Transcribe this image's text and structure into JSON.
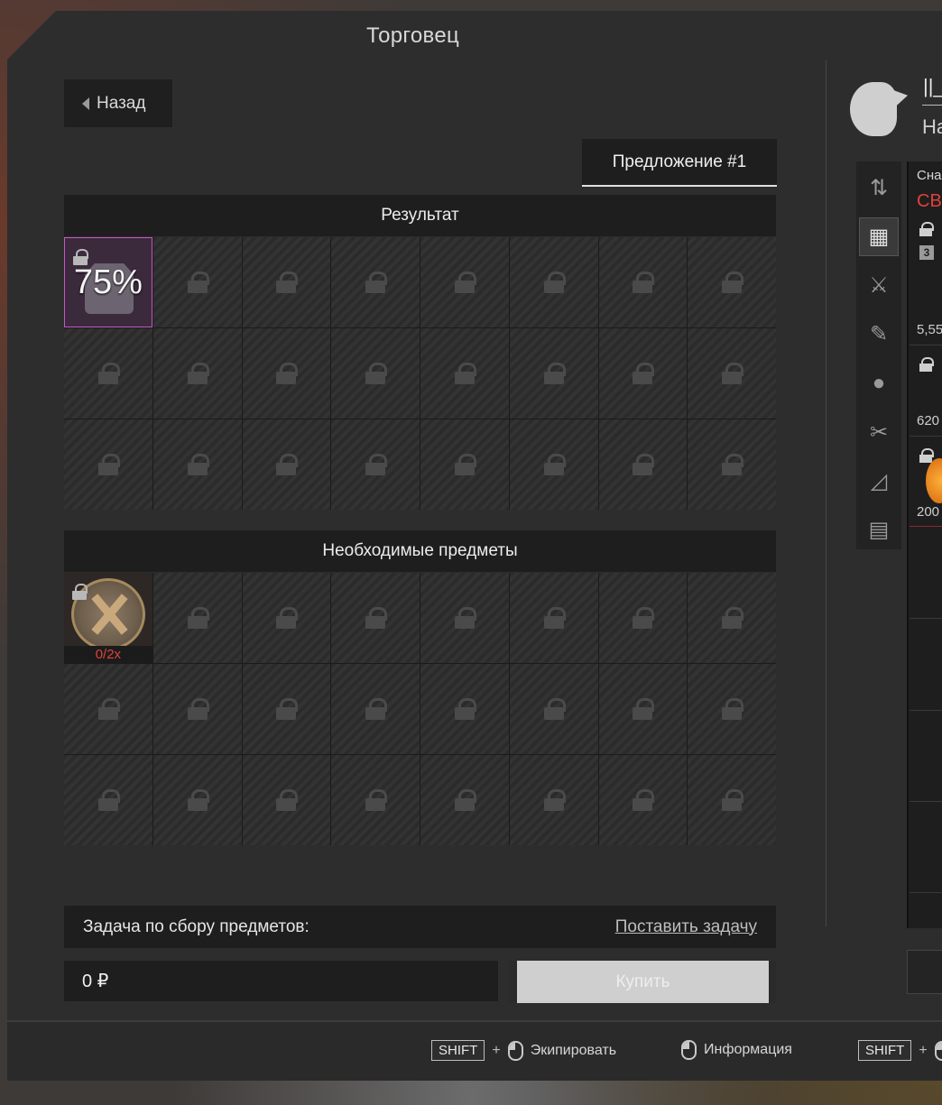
{
  "window": {
    "title": "Торговец"
  },
  "nav": {
    "back_label": "Назад"
  },
  "offer_tab": {
    "label": "Предложение #1"
  },
  "result": {
    "title": "Результат",
    "item": {
      "percent": "75%"
    }
  },
  "required": {
    "title": "Необходимые предметы",
    "item": {
      "count": "0/2x"
    }
  },
  "task": {
    "label": "Задача по сбору предметов:",
    "link": "Поставить задачу"
  },
  "price": {
    "value": "0 ₽"
  },
  "buy": {
    "label": "Купить"
  },
  "player": {
    "name": "||_",
    "sub": "На"
  },
  "categories": [
    {
      "icon": "sort-icon",
      "glyph": "⇅"
    },
    {
      "icon": "grid-icon",
      "glyph": "▦"
    },
    {
      "icon": "rifle-icon",
      "glyph": "⚔"
    },
    {
      "icon": "knife-icon",
      "glyph": "✎"
    },
    {
      "icon": "grenade-icon",
      "glyph": "●"
    },
    {
      "icon": "tools-icon",
      "glyph": "✂"
    },
    {
      "icon": "ruler-icon",
      "glyph": "◿"
    },
    {
      "icon": "box-icon",
      "glyph": "▤"
    }
  ],
  "inventory": {
    "header": "Сна",
    "tag": "СВ",
    "badge": "3",
    "values": [
      "5,55",
      "620",
      "200"
    ]
  },
  "footer": {
    "hints": [
      {
        "key": "SHIFT",
        "plus": "+",
        "label": "Экипировать"
      },
      {
        "label": "Информация"
      },
      {
        "key": "SHIFT",
        "plus": "+"
      }
    ]
  },
  "colors": {
    "accent_pink": "#c956c9",
    "alert_red": "#e0413d",
    "panel_dark": "#1e1e1e"
  }
}
